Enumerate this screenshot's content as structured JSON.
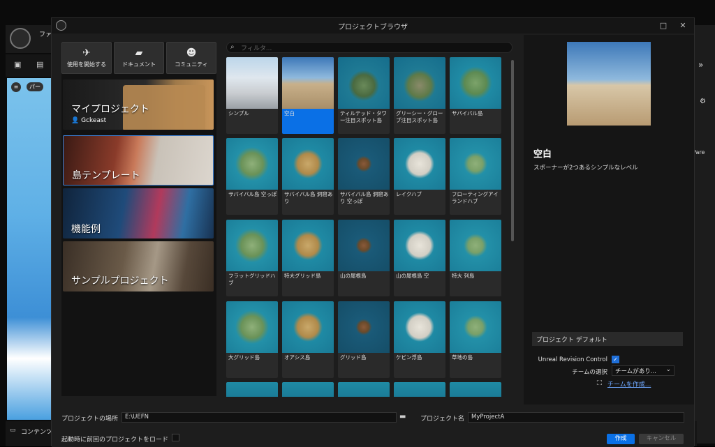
{
  "background_editor": {
    "menu_text": "ファ",
    "bottom_text": "コンテンツ",
    "viewport_label": "パー",
    "right_label": "_Pare"
  },
  "dialog": {
    "title": "プロジェクトブラウザ",
    "maximize_icon": "□",
    "close_icon": "✕"
  },
  "left": {
    "top_buttons": [
      {
        "label": "使用を開始する",
        "icon": "rocket-icon"
      },
      {
        "label": "ドキュメント",
        "icon": "book-icon"
      },
      {
        "label": "コミュニティ",
        "icon": "people-icon"
      }
    ],
    "categories": [
      {
        "label": "マイプロジェクト",
        "user": "Gckeast"
      },
      {
        "label": "島テンプレート"
      },
      {
        "label": "機能例"
      },
      {
        "label": "サンプルプロジェクト"
      }
    ]
  },
  "filter": {
    "placeholder": "フィルタ..."
  },
  "templates": [
    {
      "name": "シンプル"
    },
    {
      "name": "空白",
      "selected": true
    },
    {
      "name": "ティルテッド・タワー注目スポット島"
    },
    {
      "name": "グリーシー・グローブ注目スポット島"
    },
    {
      "name": "サバイバル島"
    },
    {
      "name": "サバイバル島 空っぽ"
    },
    {
      "name": "サバイバル島 洞窟あり"
    },
    {
      "name": "サバイバル島 洞窟あり 空っぽ"
    },
    {
      "name": "レイクハブ"
    },
    {
      "name": "フローティングアイランドハブ"
    },
    {
      "name": "フラットグリッドハブ"
    },
    {
      "name": "特大グリッド島"
    },
    {
      "name": "山の尾根島"
    },
    {
      "name": "山の尾根島 空"
    },
    {
      "name": "特大 列島"
    },
    {
      "name": "大グリッド島"
    },
    {
      "name": "オアシス島"
    },
    {
      "name": "グリッド島"
    },
    {
      "name": "ケビン浮島"
    },
    {
      "name": "草地の島"
    }
  ],
  "detail": {
    "name": "空白",
    "description": "スポーナーが2つあるシンプルなレベル",
    "defaults_header": "プロジェクト デフォルト",
    "urc_label": "Unreal Revision Control",
    "team_label": "チームの選択",
    "team_value": "チームがあり...",
    "create_team": "チームを作成..."
  },
  "bottom": {
    "location_label": "プロジェクトの場所",
    "location_value": "E:\\UEFN",
    "name_label": "プロジェクト名",
    "name_value": "MyProjectA",
    "load_label": "起動時に前回のプロジェクトをロード",
    "create_label": "作成",
    "cancel_label": "キャンセル"
  }
}
